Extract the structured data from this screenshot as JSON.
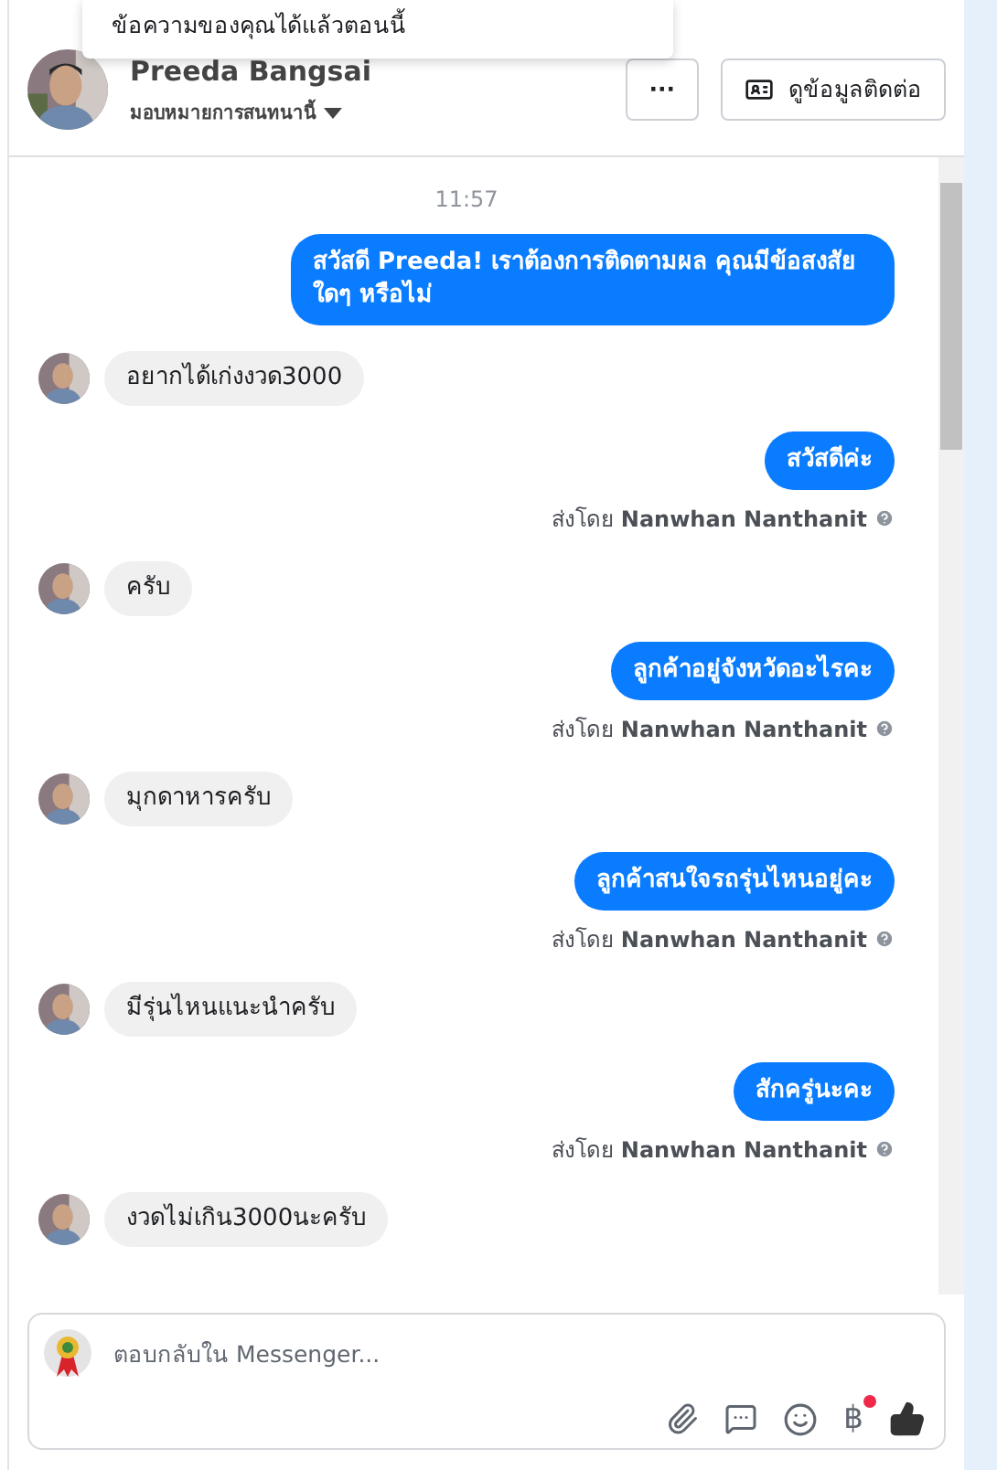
{
  "notice": {
    "text": "ข้อความของคุณได้แล้วตอนนี้"
  },
  "header": {
    "name": "Preeda Bangsai",
    "subtitle": "มอบหมายการสนทนานี้",
    "more_button": "···",
    "contact_button": "ดูข้อมูลติดต่อ"
  },
  "messages": [
    {
      "kind": "time",
      "text": "11:57"
    },
    {
      "kind": "outgoing",
      "text": "สวัสดี Preeda! เราต้องการติดตามผล คุณมีข้อสงสัยใดๆ หรือไม่"
    },
    {
      "kind": "incoming",
      "text": "อยากได้เก่งงวด3000"
    },
    {
      "kind": "outgoing",
      "text": "สวัสดีค่ะ",
      "sender": "ส่งโดย **Nanwhan Nanthanit**"
    },
    {
      "kind": "incoming",
      "text": "ครับ"
    },
    {
      "kind": "outgoing",
      "text": "ลูกค้าอยู่จังหวัดอะไรคะ",
      "sender": "ส่งโดย **Nanwhan Nanthanit**"
    },
    {
      "kind": "incoming",
      "text": "มุกดาหารครับ"
    },
    {
      "kind": "outgoing",
      "text": "ลูกค้าสนใจรถรุ่นไหนอยู่คะ",
      "sender": "ส่งโดย **Nanwhan Nanthanit**"
    },
    {
      "kind": "incoming",
      "text": "มีรุ่นไหนแนะนำครับ"
    },
    {
      "kind": "outgoing",
      "text": "สักครู่นะคะ",
      "sender": "ส่งโดย **Nanwhan Nanthanit**"
    },
    {
      "kind": "incoming",
      "text": "งวดไม่เกิน3000นะครับ"
    }
  ],
  "composer": {
    "placeholder": "ตอบกลับใน Messenger...",
    "currency": "฿"
  }
}
